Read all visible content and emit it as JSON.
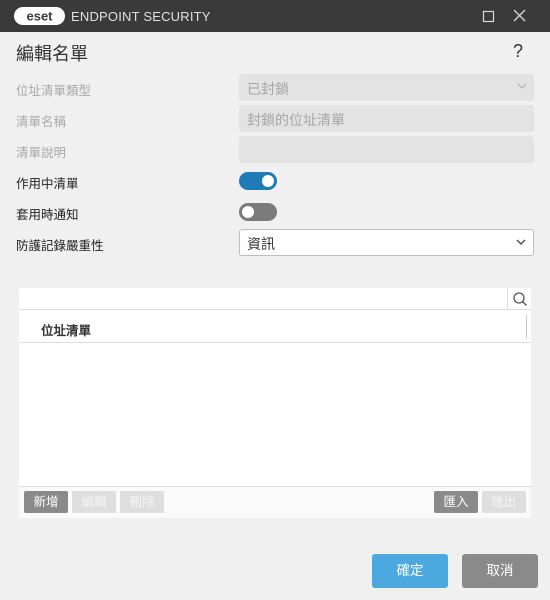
{
  "window": {
    "logo_text": "eset",
    "app_title": "ENDPOINT SECURITY"
  },
  "dialog": {
    "title": "編輯名單",
    "help_label": "?"
  },
  "form": {
    "list_type_label": "位址清單類型",
    "list_type_value": "已封鎖",
    "list_name_label": "清單名稱",
    "list_name_value": "封鎖的位址清單",
    "list_desc_label": "清單說明",
    "list_desc_value": "",
    "active_label": "作用中清單",
    "active_on": true,
    "notify_label": "套用時通知",
    "notify_on": false,
    "severity_label": "防護記錄嚴重性",
    "severity_value": "資訊"
  },
  "address_list": {
    "search_value": "",
    "column_header": "位址清單",
    "rows": [],
    "buttons": {
      "add": "新增",
      "edit": "編輯",
      "delete": "刪除",
      "import": "匯入",
      "export": "匯出"
    }
  },
  "footer": {
    "ok_label": "確定",
    "cancel_label": "取消"
  },
  "colors": {
    "titlebar": "#3a3a3a",
    "accent_toggle": "#1f7bb6",
    "primary_button": "#4ba9e0",
    "secondary_button": "#8a8a8a"
  }
}
